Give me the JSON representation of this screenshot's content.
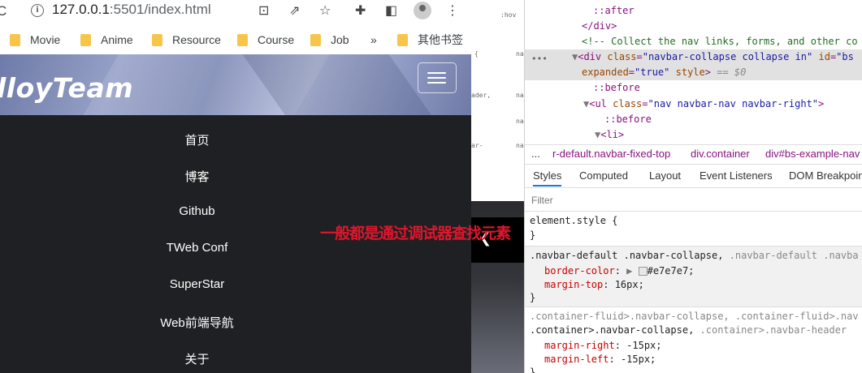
{
  "browser": {
    "url_host": "127.0.0.1",
    "url_rest": ":5501/index.html",
    "bookmarks": [
      "Movie",
      "Anime",
      "Resource",
      "Course",
      "Job"
    ],
    "bookmarks_more": "»",
    "bookmark_other": "其他书签"
  },
  "site": {
    "brand": "lloyTeam",
    "nav": [
      "首页",
      "博客",
      "Github",
      "TWeb Conf",
      "SuperStar",
      "Web前端导航",
      "关于"
    ]
  },
  "annotation": "一般都是通过调试器查找元素",
  "middle": {
    "labels": [
      ":hov",
      "{",
      "na",
      "ader,",
      "na",
      "na",
      "ar-",
      "na"
    ]
  },
  "devtools": {
    "elements": {
      "l1": "::after",
      "l2": "</div>",
      "l3": "<!-- Collect the nav links, forms, and other co",
      "l4_tag": "<div",
      "l4_class_attr": "class",
      "l4_class_val": "\"navbar-collapse collapse in\"",
      "l4_id_attr": "id",
      "l4_id_val": "\"bs",
      "l5_attr": "expanded",
      "l5_val": "\"true\"",
      "l5_style": "style",
      "l5_tail": "== $0",
      "l6": "::before",
      "l7_tag": "<ul",
      "l7_attr": "class",
      "l7_val": "\"nav navbar-nav navbar-right\"",
      "l8": "::before",
      "l9": "<li>"
    },
    "breadcrumbs": [
      "... ",
      "r-default.navbar-fixed-top",
      "div.container",
      "div#bs-example-nav"
    ],
    "tabs": [
      "Styles",
      "Computed",
      "Layout",
      "Event Listeners",
      "DOM Breakpoin"
    ],
    "filter_placeholder": "Filter",
    "rules": {
      "element_style": "element.style {",
      "r2_selector": ".navbar-default .navbar-collapse,",
      "r2_selector_gray": ".navbar-default .navba",
      "r2_prop1": "border-color",
      "r2_val1": "#e7e7e7;",
      "r2_prop2": "margin-top",
      "r2_val2": "16px;",
      "r3_sel1": ".container-fluid>.navbar-collapse, .container-fluid>.nav",
      "r3_sel2a": ".container>.navbar-collapse,",
      "r3_sel2b": ".container>.navbar-header",
      "r3_prop1": "margin-right",
      "r3_val1": "-15px;",
      "r3_prop2": "margin-left",
      "r3_val2": "-15px;",
      "close": "}"
    }
  },
  "colors": {
    "annotation": "#e0162b",
    "nav_bg": "#1f2024",
    "swatch": "#e7e7e7"
  }
}
